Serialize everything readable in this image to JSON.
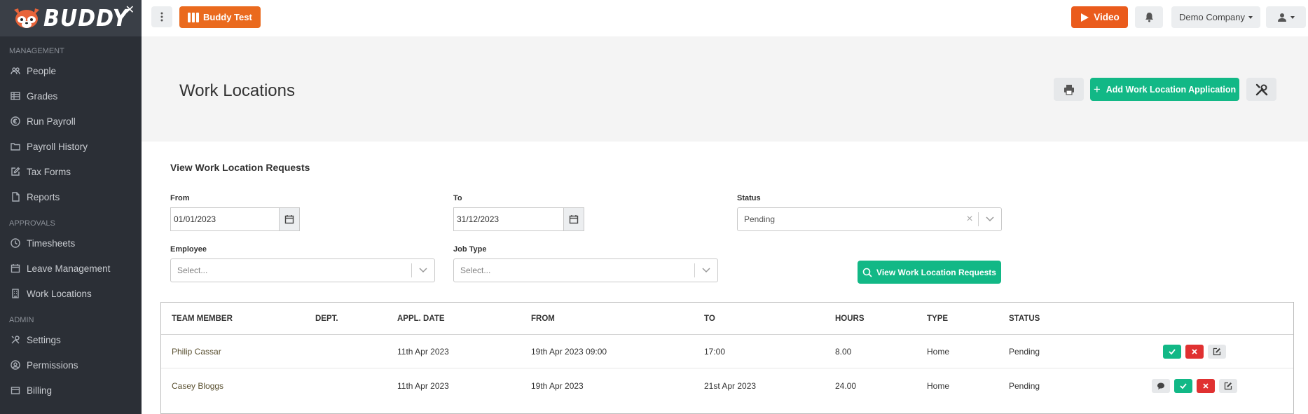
{
  "brand": {
    "name": "BUDDY"
  },
  "sidebar": {
    "sections": [
      {
        "title": "MANAGEMENT",
        "items": [
          {
            "label": "People",
            "icon": "people-icon"
          },
          {
            "label": "Grades",
            "icon": "grades-icon"
          },
          {
            "label": "Run Payroll",
            "icon": "euro-icon"
          },
          {
            "label": "Payroll History",
            "icon": "folder-icon"
          },
          {
            "label": "Tax Forms",
            "icon": "edit-icon"
          },
          {
            "label": "Reports",
            "icon": "document-icon"
          }
        ]
      },
      {
        "title": "APPROVALS",
        "items": [
          {
            "label": "Timesheets",
            "icon": "clock-icon"
          },
          {
            "label": "Leave Management",
            "icon": "calendar-icon"
          },
          {
            "label": "Work Locations",
            "icon": "building-icon"
          }
        ]
      },
      {
        "title": "ADMIN",
        "items": [
          {
            "label": "Settings",
            "icon": "tools-icon"
          },
          {
            "label": "Permissions",
            "icon": "users-icon"
          },
          {
            "label": "Billing",
            "icon": "billing-icon"
          }
        ]
      }
    ]
  },
  "topbar": {
    "app_button": "Buddy Test",
    "video_label": "Video",
    "company_label": "Demo Company",
    "accent": "#ea6a1e"
  },
  "header": {
    "title": "Work Locations",
    "add_label": "Add Work Location Application"
  },
  "filters": {
    "section_title": "View Work Location Requests",
    "from_label": "From",
    "from_value": "01/01/2023",
    "to_label": "To",
    "to_value": "31/12/2023",
    "status_label": "Status",
    "status_value": "Pending",
    "employee_label": "Employee",
    "employee_placeholder": "Select...",
    "jobtype_label": "Job Type",
    "jobtype_placeholder": "Select...",
    "view_button": "View Work Location Requests"
  },
  "table": {
    "columns": [
      "TEAM MEMBER",
      "DEPT.",
      "APPL. DATE",
      "FROM",
      "TO",
      "HOURS",
      "TYPE",
      "STATUS"
    ],
    "rows": [
      {
        "member": "Philip Cassar",
        "dept": "",
        "appl_date": "11th Apr 2023",
        "from": "19th Apr 2023 09:00",
        "to": "17:00",
        "hours": "8.00",
        "type": "Home",
        "status": "Pending"
      },
      {
        "member": "Casey Bloggs",
        "dept": "",
        "appl_date": "11th Apr 2023",
        "from": "19th Apr 2023",
        "to": "21st Apr 2023",
        "hours": "24.00",
        "type": "Home",
        "status": "Pending"
      }
    ]
  },
  "colors": {
    "green": "#12b886",
    "red": "#e03131",
    "sidebar_bg": "#2b2f36"
  }
}
